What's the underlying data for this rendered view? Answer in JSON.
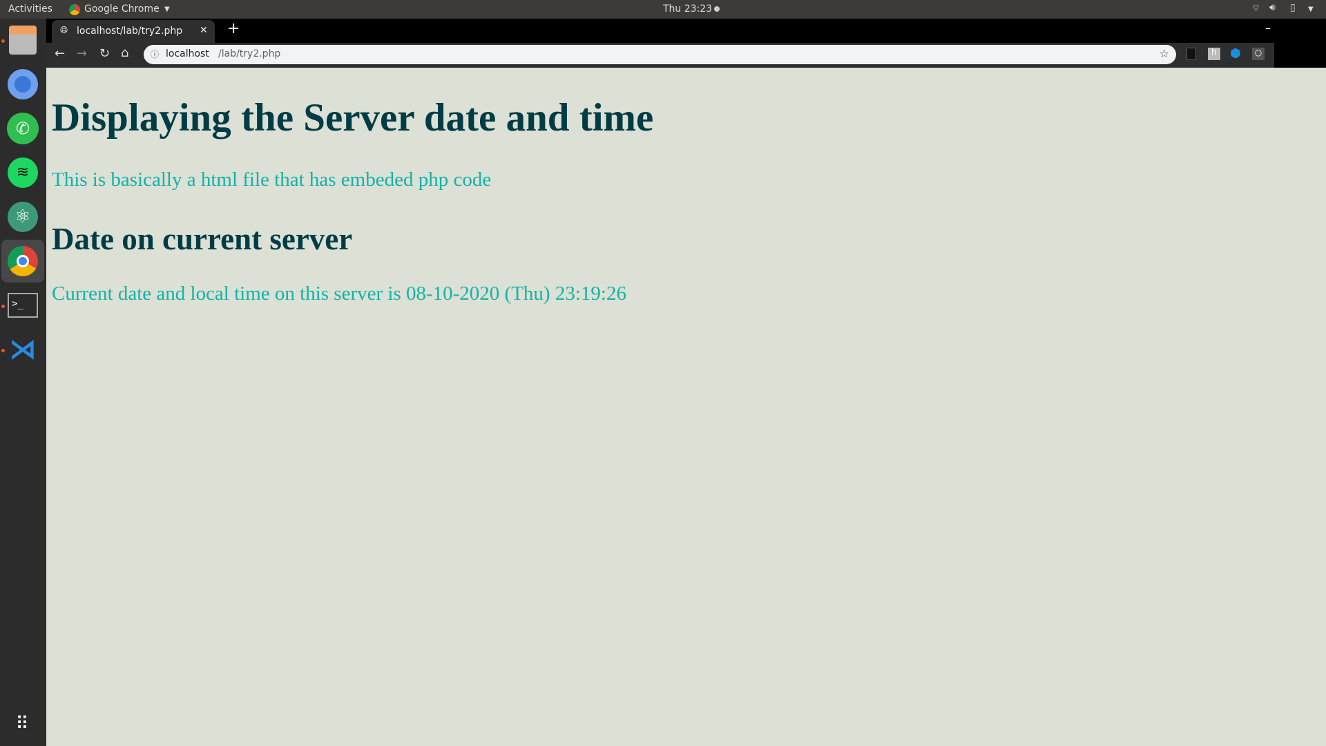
{
  "topbar": {
    "activities": "Activities",
    "app_name": "Google Chrome",
    "clock": "Thu 23:23"
  },
  "browser": {
    "tab_title": "localhost/lab/try2.php",
    "url_host": "localhost",
    "url_path": "/lab/try2.php"
  },
  "page": {
    "heading": "Displaying the Server date and time",
    "intro": "This is basically a html file that has embeded php code",
    "subheading": "Date on current server",
    "date_line": "Current date and local time on this server is 08-10-2020 (Thu) 23:19:26"
  },
  "colors": {
    "heading": "#003c46",
    "text": "#13b3a8",
    "background": "#dce0d5"
  }
}
